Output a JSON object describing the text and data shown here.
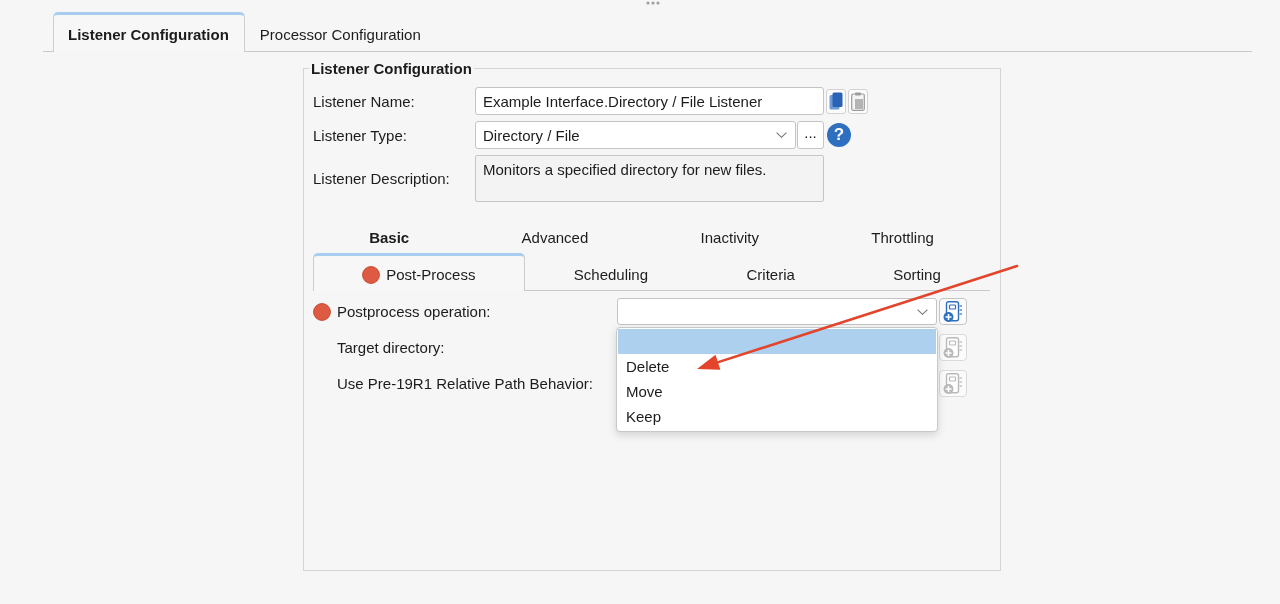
{
  "tabs": [
    {
      "label": "Listener Configuration",
      "selected": true
    },
    {
      "label": "Processor Configuration",
      "selected": false
    }
  ],
  "listener_configuration": {
    "title": "Listener Configuration",
    "fields": [
      {
        "kind": "text",
        "label": "Listener Name:",
        "value": "Example Interface.Directory / File Listener"
      },
      {
        "kind": "select",
        "label": "Listener Type:",
        "value": "Directory / File",
        "browse_label": "...",
        "help_label": "?"
      },
      {
        "kind": "textarea",
        "label": "Listener Description:",
        "value": "Monitors a specified directory for new files."
      }
    ],
    "settings_tabs": [
      [
        {
          "label": "Basic",
          "selected": false,
          "bold": true,
          "error": false
        },
        {
          "label": "Advanced",
          "selected": false,
          "bold": false,
          "error": false
        },
        {
          "label": "Inactivity",
          "selected": false,
          "bold": false,
          "error": false
        },
        {
          "label": "Throttling",
          "selected": false,
          "bold": false,
          "error": false
        }
      ],
      [
        {
          "label": "Post-Process",
          "selected": true,
          "bold": false,
          "error": true
        },
        {
          "label": "Scheduling",
          "selected": false,
          "bold": false,
          "error": false
        },
        {
          "label": "Criteria",
          "selected": false,
          "bold": false,
          "error": false
        },
        {
          "label": "Sorting",
          "selected": false,
          "bold": false,
          "error": false
        }
      ]
    ],
    "settings": [
      {
        "label": "Postprocess operation:",
        "error": true,
        "action_disabled": false,
        "field": {
          "kind": "select",
          "open": true,
          "options": [
            {
              "kind": "blank",
              "selected": true
            },
            {
              "kind": "text",
              "label": "Delete",
              "selected": false
            },
            {
              "kind": "text",
              "label": "Move",
              "selected": false
            },
            {
              "kind": "text",
              "label": "Keep",
              "selected": false
            }
          ]
        }
      },
      {
        "label": "Target directory:",
        "error": false,
        "action_disabled": true
      },
      {
        "label": "Use Pre-19R1 Relative Path Behavior:",
        "error": false,
        "action_disabled": true
      }
    ]
  },
  "annotation": {
    "kind": "arrow"
  }
}
